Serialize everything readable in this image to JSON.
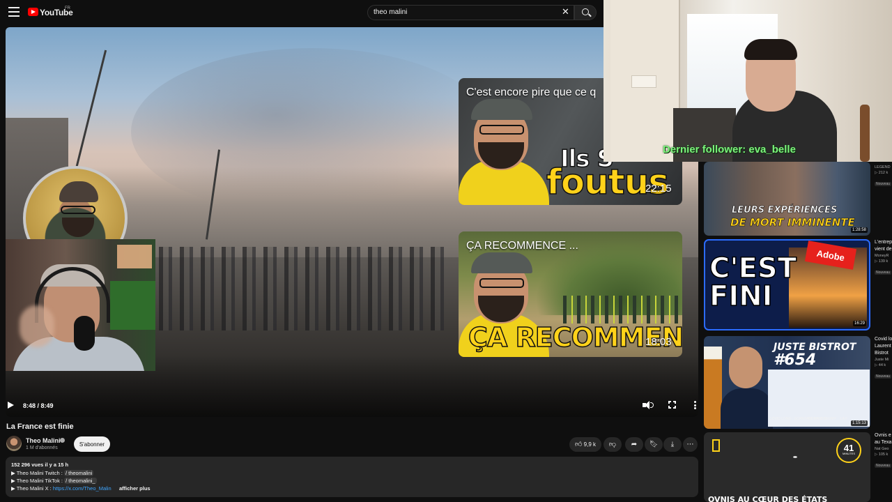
{
  "header": {
    "logo_text": "YouTube",
    "country": "FR",
    "search_value": "theo malini"
  },
  "player": {
    "time": "8:48 / 8:49",
    "overlay1": {
      "caption": "C'est encore pire que ce q",
      "big1": "Ils S",
      "big2": "foutus",
      "duration": "22:15"
    },
    "overlay2": {
      "caption": "ÇA RECOMMENCE ...",
      "big_yellow": "ÇA RECOMMENCE",
      "big_dots": "...",
      "duration": "18:03"
    }
  },
  "video": {
    "title": "La France est finie",
    "channel": "Theo Malini",
    "subscribers": "1 M d'abonnés",
    "subscribe_label": "S'abonner",
    "likes": "9,9 k",
    "meta": "152 296 vues  il y a 15 h",
    "desc_lines": [
      {
        "prefix": "▶ Theo Malini Twitch : ",
        "handle": "/ theomalini"
      },
      {
        "prefix": "▶ Theo Malini TikTok : ",
        "handle": "/ theomalini_"
      },
      {
        "prefix": "▶ Theo Malini X : ",
        "link": "https://x.com/Theo_Malin"
      }
    ],
    "show_more": "afficher plus"
  },
  "stream": {
    "follower": "Dernier follower: eva_belle"
  },
  "sidebar": {
    "items": [
      {
        "thumb_line1": "LEURS EXPÉRIENCES",
        "thumb_line2": "DE MORT IMMINENTE",
        "duration": "1:28:58",
        "title": "LEGEND",
        "channel": "",
        "views": "▷ 212 k",
        "badge": "Nouveau"
      },
      {
        "thumb_text": "C'EST FINI",
        "thumb_logo": "Adobe",
        "duration": "16:29",
        "title": "L'entrep",
        "title2": "vient de",
        "channel": "MoneyR",
        "views": "▷ 139 k",
        "badge": "Nouveau"
      },
      {
        "thumb_line1": "JUSTE BISTROT",
        "thumb_line2": "#654",
        "labels": [
          "COVID LONG : SCANDALE EN VUE",
          "DONALD TRUMP",
          "LA F"
        ],
        "duration": "1:15:13",
        "title": "Covid lo",
        "title2": "Laurent",
        "title3": "Bistrot",
        "channel": "Juste Mi",
        "views": "▷ 44 k",
        "badge": "Nouveau"
      },
      {
        "thumb_badge_num": "41",
        "thumb_badge_unit": "MINUTES",
        "thumb_caption": "OVNIS AU CŒUR DES ÉTATS",
        "title": "Ovnis e",
        "title2": "au Texa",
        "channel": "Nat Geo",
        "views": "▷ 105 k",
        "badge": "Nouveau"
      }
    ]
  }
}
